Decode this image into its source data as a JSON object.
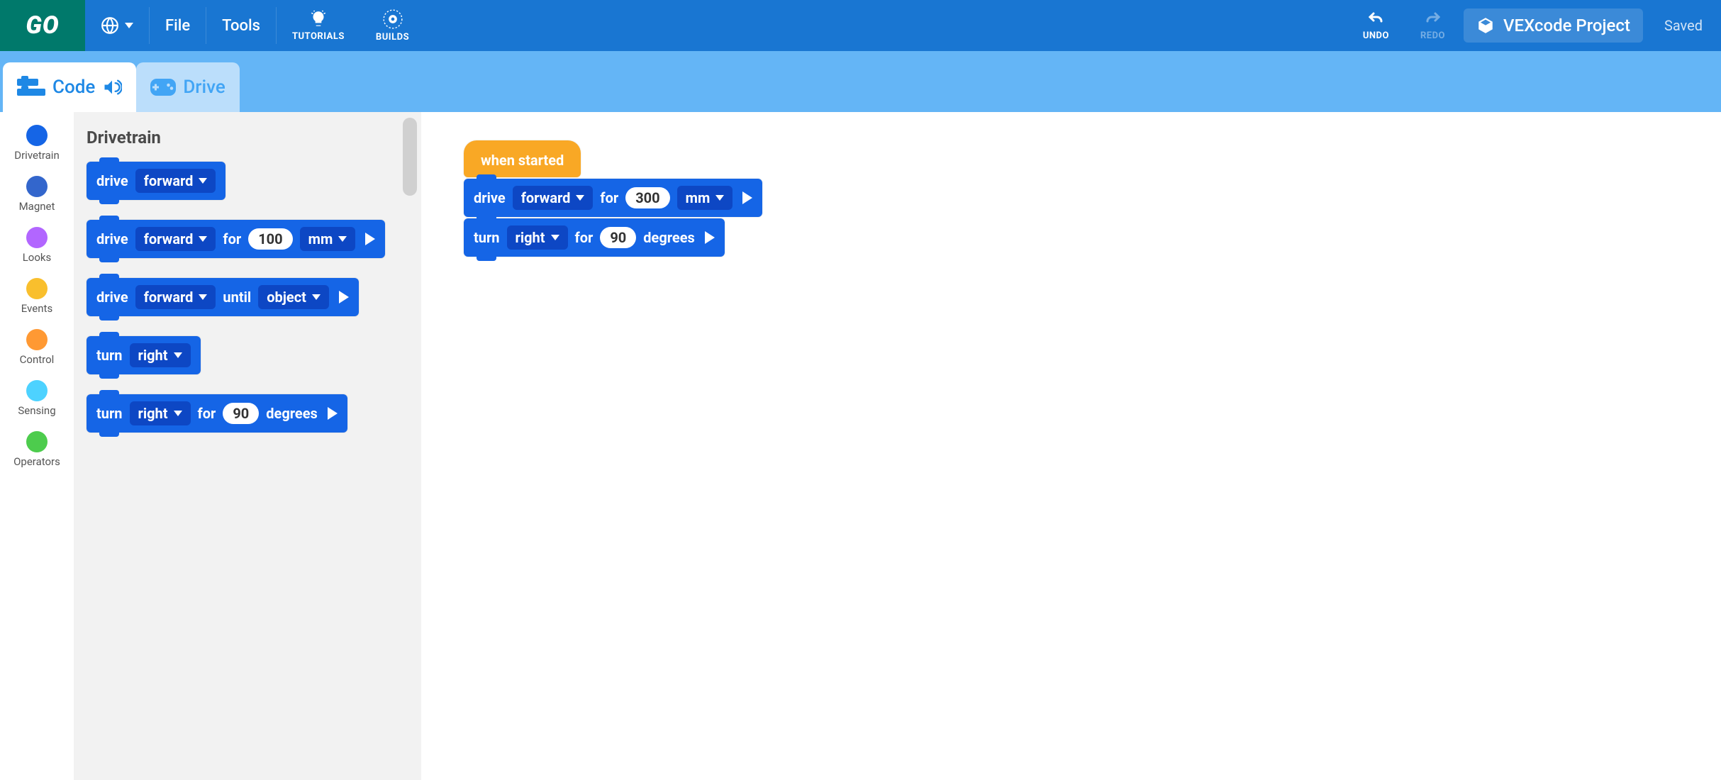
{
  "toolbar": {
    "logo": "GO",
    "file": "File",
    "tools": "Tools",
    "tutorials": "TUTORIALS",
    "builds": "BUILDS",
    "undo": "UNDO",
    "redo": "REDO",
    "project_name": "VEXcode Project",
    "saved": "Saved"
  },
  "tabs": {
    "code": "Code",
    "drive": "Drive"
  },
  "categories": [
    {
      "label": "Drivetrain",
      "color": "#1565e6"
    },
    {
      "label": "Magnet",
      "color": "#3366cc"
    },
    {
      "label": "Looks",
      "color": "#b266ff"
    },
    {
      "label": "Events",
      "color": "#f9bf2d"
    },
    {
      "label": "Control",
      "color": "#ff9933"
    },
    {
      "label": "Sensing",
      "color": "#4dd2ff"
    },
    {
      "label": "Operators",
      "color": "#4dcc4d"
    }
  ],
  "palette": {
    "title": "Drivetrain",
    "blocks": {
      "b1_cmd": "drive",
      "b1_dir": "forward",
      "b2_cmd": "drive",
      "b2_dir": "forward",
      "b2_for": "for",
      "b2_val": "100",
      "b2_unit": "mm",
      "b3_cmd": "drive",
      "b3_dir": "forward",
      "b3_until": "until",
      "b3_obj": "object",
      "b4_cmd": "turn",
      "b4_dir": "right",
      "b5_cmd": "turn",
      "b5_dir": "right",
      "b5_for": "for",
      "b5_val": "90",
      "b5_unit": "degrees"
    }
  },
  "script": {
    "hat": "when started",
    "s1_cmd": "drive",
    "s1_dir": "forward",
    "s1_for": "for",
    "s1_val": "300",
    "s1_unit": "mm",
    "s2_cmd": "turn",
    "s2_dir": "right",
    "s2_for": "for",
    "s2_val": "90",
    "s2_unit": "degrees"
  }
}
